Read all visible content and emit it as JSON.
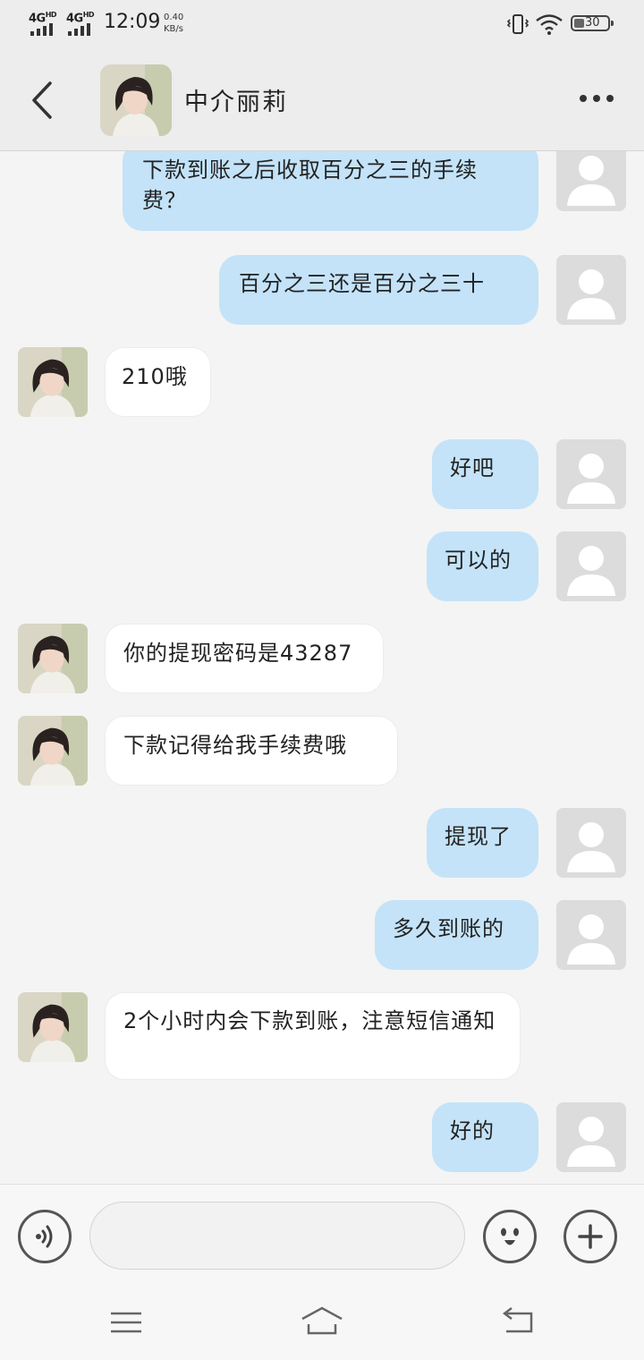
{
  "status_bar": {
    "network_1": "4G",
    "network_1_sup": "HD",
    "network_2": "4G",
    "network_2_sup": "HD",
    "time": "12:09",
    "speed_value": "0.40",
    "speed_unit": "KB/s",
    "battery": "30"
  },
  "header": {
    "title": "中介丽莉",
    "back_icon": "chevron-left-icon",
    "more_icon": "more-dots-icon"
  },
  "messages": [
    {
      "sender": "me",
      "text": "下款到账之后收取百分之三的手续费？"
    },
    {
      "sender": "me",
      "text": "百分之三还是百分之三十"
    },
    {
      "sender": "them",
      "text": "210哦"
    },
    {
      "sender": "me",
      "text": "好吧"
    },
    {
      "sender": "me",
      "text": "可以的"
    },
    {
      "sender": "them",
      "text": "你的提现密码是43287"
    },
    {
      "sender": "them",
      "text": "下款记得给我手续费哦"
    },
    {
      "sender": "me",
      "text": "提现了"
    },
    {
      "sender": "me",
      "text": "多久到账的"
    },
    {
      "sender": "them",
      "text": "2个小时内会下款到账，注意短信通知"
    },
    {
      "sender": "me",
      "text": "好的"
    }
  ],
  "input_bar": {
    "placeholder": "",
    "voice_icon": "voice-icon",
    "emoji_icon": "emoji-icon",
    "plus_icon": "plus-icon"
  },
  "nav_bar": {
    "menu_icon": "menu-icon",
    "home_icon": "home-icon",
    "back_icon": "back-arrow-icon"
  },
  "colors": {
    "my_bubble": "#c4e3f8",
    "their_bubble": "#ffffff",
    "header_bg": "#ededed",
    "chat_bg": "#f4f4f4"
  }
}
